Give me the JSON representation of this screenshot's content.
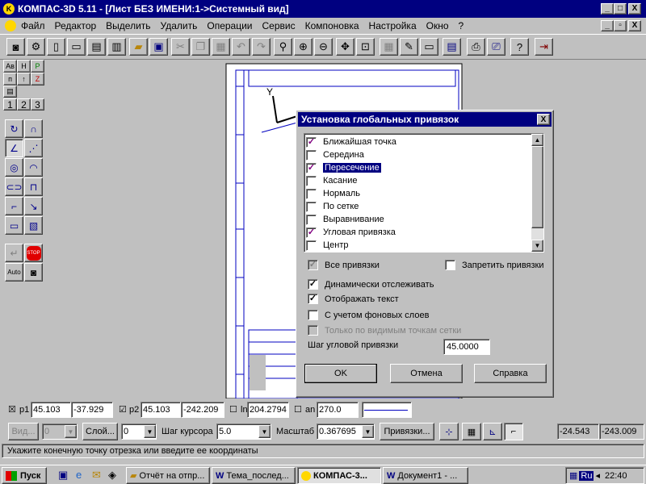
{
  "window": {
    "title": "КОМПАС-3D 5.11 - [Лист БЕЗ ИМЕНИ:1->Системный вид]",
    "controls": [
      "_",
      "□",
      "X"
    ],
    "doc_controls": [
      "_",
      "▫",
      "X"
    ]
  },
  "menu": [
    "Файл",
    "Редактор",
    "Выделить",
    "Удалить",
    "Операции",
    "Сервис",
    "Компоновка",
    "Настройка",
    "Окно",
    "?"
  ],
  "left_panel": {
    "tab_row1": [
      "Ав",
      "Н",
      "P"
    ],
    "tab_row2": [
      "п",
      "↑",
      "Z"
    ],
    "pages": [
      "1",
      "2",
      "3"
    ]
  },
  "canvas": {
    "axis_y_label": "Y"
  },
  "dialog": {
    "title": "Установка глобальных привязок",
    "close": "X",
    "items": [
      {
        "label": "Ближайшая точка",
        "checked": true,
        "selected": false
      },
      {
        "label": "Середина",
        "checked": false,
        "selected": false
      },
      {
        "label": "Пересечение",
        "checked": true,
        "selected": true
      },
      {
        "label": "Касание",
        "checked": false,
        "selected": false
      },
      {
        "label": "Нормаль",
        "checked": false,
        "selected": false
      },
      {
        "label": "По сетке",
        "checked": false,
        "selected": false
      },
      {
        "label": "Выравнивание",
        "checked": false,
        "selected": false
      },
      {
        "label": "Угловая привязка",
        "checked": true,
        "selected": false
      },
      {
        "label": "Центр",
        "checked": false,
        "selected": false
      }
    ],
    "all_snaps": "Все привязки",
    "forbid_snaps": "Запретить привязки",
    "dynamic_tracking": "Динамически отслеживать",
    "show_text": "Отображать текст",
    "background_layers": "С учетом фоновых слоев",
    "visible_grid_only": "Только по видимым точкам сетки",
    "angle_step_label": "Шаг угловой привязки",
    "angle_step_value": "45.0000",
    "ok": "OK",
    "cancel": "Отмена",
    "help": "Справка"
  },
  "status": {
    "p1_label": "p1",
    "p1_x": "45.103",
    "p1_y": "-37.929",
    "p2_label": "p2",
    "p2_x": "45.103",
    "p2_y": "-242.209",
    "ln_label": "ln",
    "ln_value": "204.2794",
    "an_label": "an",
    "an_value": "270.0",
    "view_label": "Вид...",
    "view_value": "0",
    "layer_label": "Слой...",
    "layer_value": "0",
    "cursor_step_label": "Шаг курсора",
    "cursor_step_value": "5.0",
    "scale_label": "Масштаб",
    "scale_value": "0.367695",
    "snaps_button": "Привязки...",
    "coord_x": "-24.543",
    "coord_y": "-243.009",
    "hint": "Укажите конечную точку отрезка или введите ее координаты"
  },
  "taskbar": {
    "start": "Пуск",
    "tasks": [
      "Отчёт на отпр...",
      "Тема_послед...",
      "КОМПАС-3...",
      "Документ1 - ..."
    ],
    "lang": "Ru",
    "time": "22:40"
  }
}
